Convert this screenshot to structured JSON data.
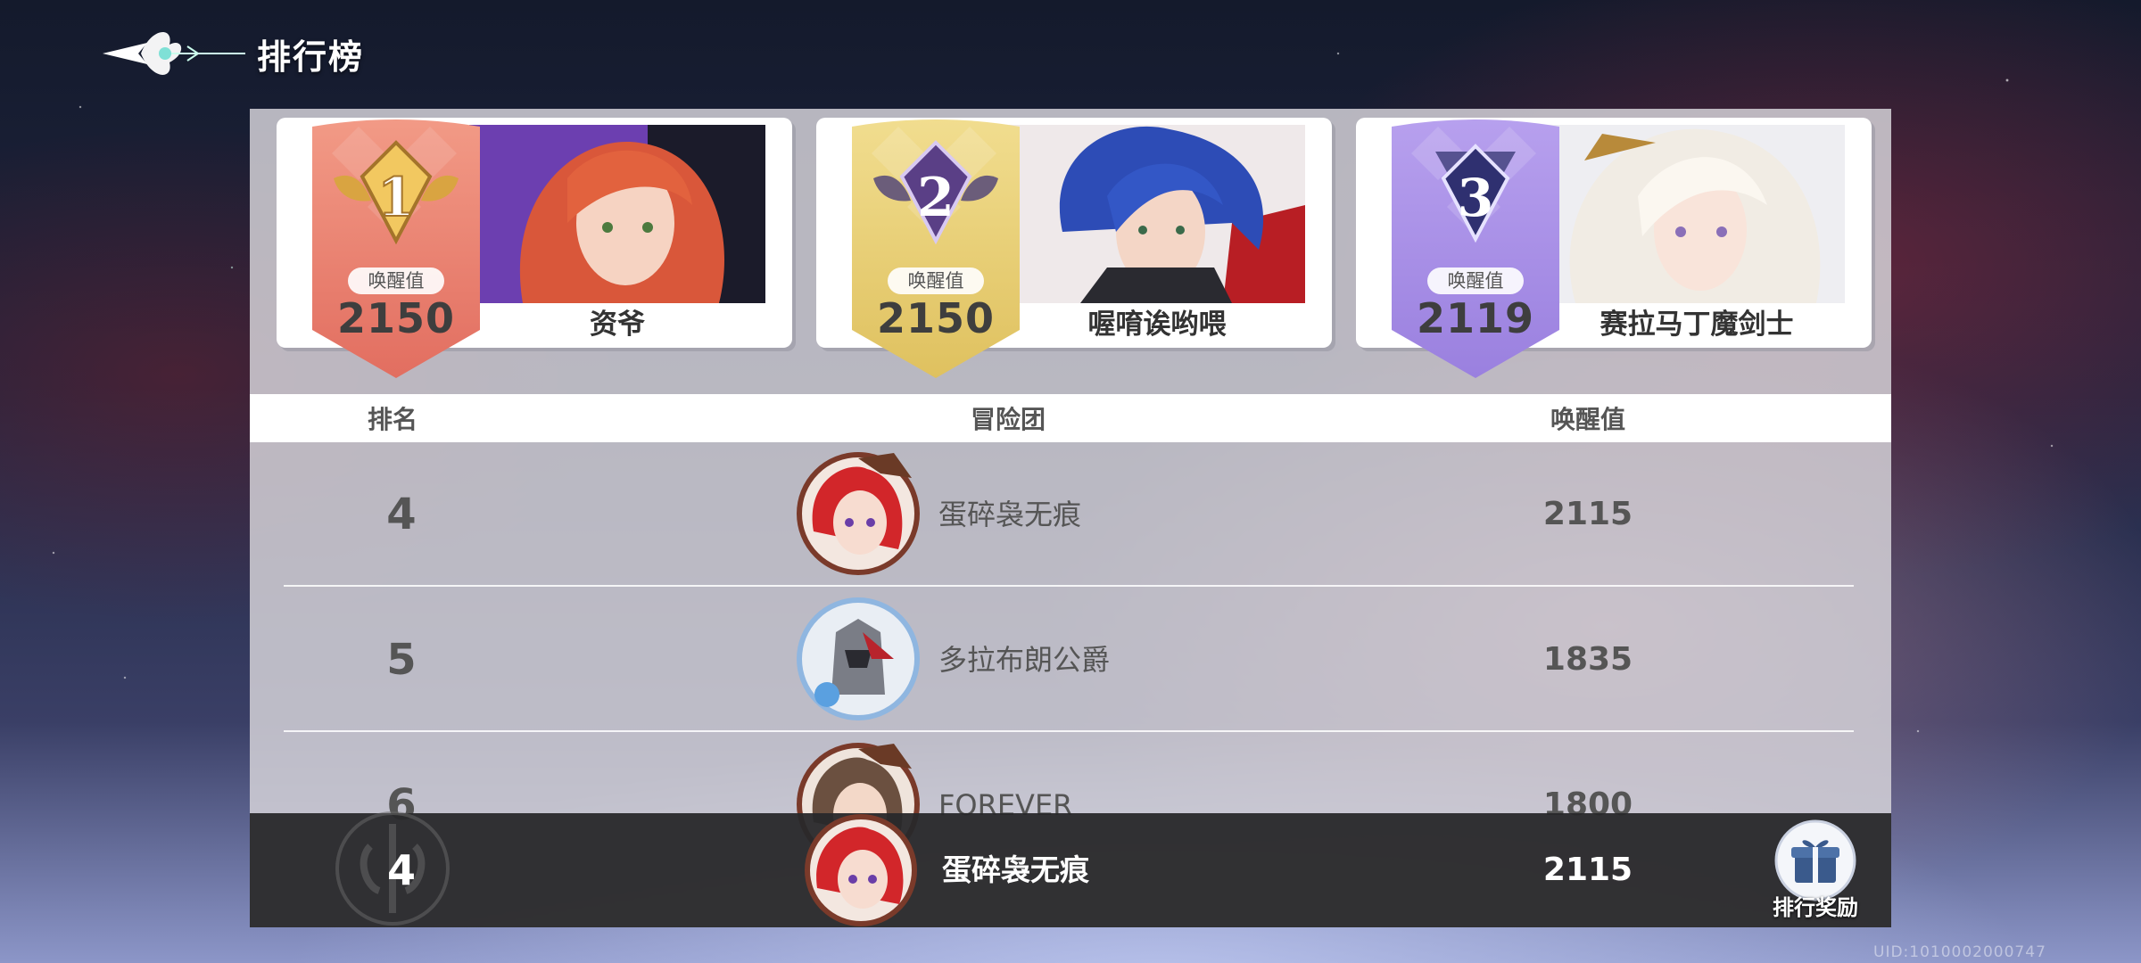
{
  "header": {
    "title": "排行榜",
    "back_icon": "winged-back-emblem-icon"
  },
  "podium": [
    {
      "rank": "1",
      "score_label": "唤醒值",
      "score": "2150",
      "name": "资爷",
      "color": "#e8796a",
      "accent": "#d9a441"
    },
    {
      "rank": "2",
      "score_label": "唤醒值",
      "score": "2150",
      "name": "喔唷诶哟喂",
      "color": "#e6c96a",
      "accent": "#6b4f8a"
    },
    {
      "rank": "3",
      "score_label": "唤醒值",
      "score": "2119",
      "name": "赛拉马丁魔剑士",
      "color": "#a58be0",
      "accent": "#3c3c78"
    }
  ],
  "table": {
    "headers": {
      "rank": "排名",
      "team": "冒险团",
      "score": "唤醒值"
    },
    "rows": [
      {
        "rank": "4",
        "team": "蛋碎袅无痕",
        "score": "2115"
      },
      {
        "rank": "5",
        "team": "多拉布朗公爵",
        "score": "1835"
      },
      {
        "rank": "6",
        "team": "FOREVER",
        "score": "1800"
      }
    ]
  },
  "my_rank": {
    "rank": "4",
    "team": "蛋碎袅无痕",
    "score": "2115"
  },
  "reward_button": {
    "label": "排行奖励",
    "icon": "gift-icon"
  },
  "uid": "UID:1010002000747"
}
